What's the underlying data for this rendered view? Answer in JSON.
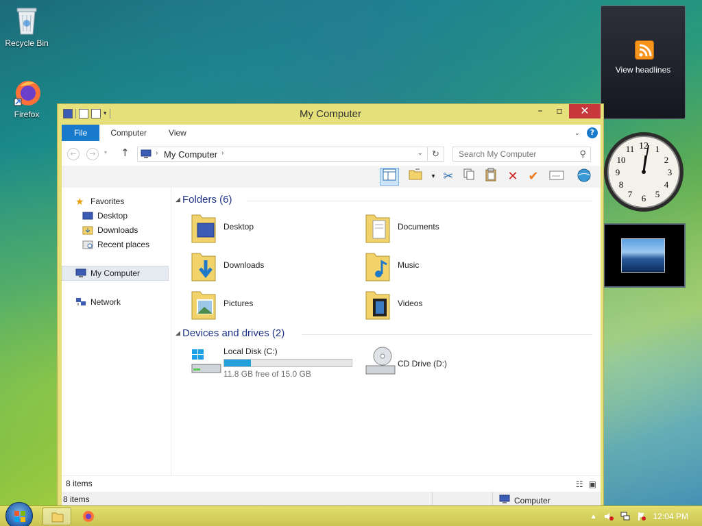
{
  "desktop": {
    "icons": [
      {
        "label": "Recycle Bin"
      },
      {
        "label": "Firefox"
      }
    ]
  },
  "gadgets": {
    "rss_label": "View headlines",
    "clock_numbers": [
      "12",
      "1",
      "2",
      "3",
      "4",
      "5",
      "6",
      "7",
      "8",
      "9",
      "10",
      "11"
    ]
  },
  "window": {
    "title": "My Computer",
    "ribbon_tabs": [
      "File",
      "Computer",
      "View"
    ],
    "address": {
      "crumb": "My Computer"
    },
    "search_placeholder": "Search My Computer",
    "nav": {
      "favorites": "Favorites",
      "desktop": "Desktop",
      "downloads": "Downloads",
      "recent": "Recent places",
      "my_computer": "My Computer",
      "network": "Network"
    },
    "folders_header": "Folders (6)",
    "folders": [
      "Desktop",
      "Documents",
      "Downloads",
      "Music",
      "Pictures",
      "Videos"
    ],
    "devices_header": "Devices and drives (2)",
    "drives": [
      {
        "name": "Local Disk (C:)",
        "free": "11.8 GB free of 15.0 GB",
        "used_fraction": 0.21
      },
      {
        "name": "CD Drive (D:)"
      }
    ],
    "status_count": "8 items",
    "status2_count": "8 items",
    "status2_location": "Computer"
  },
  "taskbar": {
    "time": "12:04 PM"
  },
  "colors": {
    "window_frame": "#e5e07a",
    "accent": "#1979ca",
    "close": "#c7383d",
    "header_text": "#1e3287",
    "drive_fill": "#26a0da"
  }
}
